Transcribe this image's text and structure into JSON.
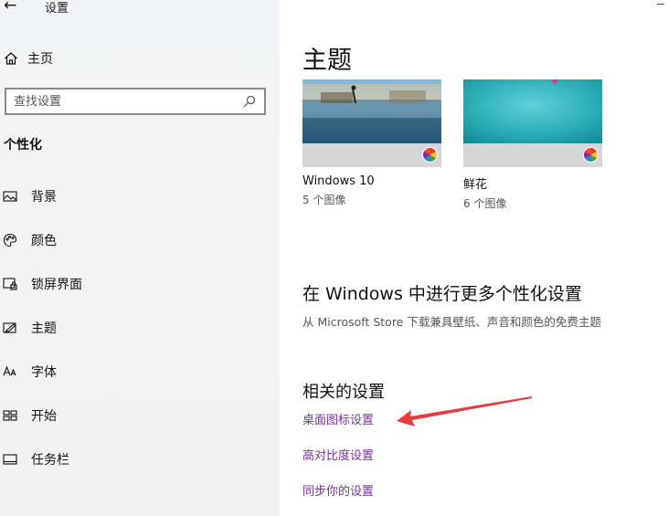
{
  "window": {
    "title": "设置",
    "back_symbol": "←"
  },
  "sidebar": {
    "home_label": "主页",
    "search_placeholder": "查找设置",
    "section_title": "个性化",
    "items": [
      {
        "label": "背景",
        "icon": "picture-icon"
      },
      {
        "label": "颜色",
        "icon": "palette-icon"
      },
      {
        "label": "锁屏界面",
        "icon": "lock-screen-icon"
      },
      {
        "label": "主题",
        "icon": "theme-icon"
      },
      {
        "label": "字体",
        "icon": "font-icon"
      },
      {
        "label": "开始",
        "icon": "start-icon"
      },
      {
        "label": "任务栏",
        "icon": "taskbar-icon"
      }
    ]
  },
  "main": {
    "page_title": "主题",
    "themes": [
      {
        "name": "Windows 10",
        "count": "5 个图像"
      },
      {
        "name": "鲜花",
        "count": "6 个图像"
      }
    ],
    "more_title": "在 Windows 中进行更多个性化设置",
    "more_desc": "从 Microsoft Store 下载兼具壁纸、声音和颜色的免费主题",
    "related_title": "相关的设置",
    "related_links": [
      "桌面图标设置",
      "高对比度设置",
      "同步你的设置"
    ]
  },
  "colors": {
    "link": "#7b2fa6",
    "annotation_arrow": "#e83a3a",
    "sidebar_bg": "#f2f2f2"
  }
}
